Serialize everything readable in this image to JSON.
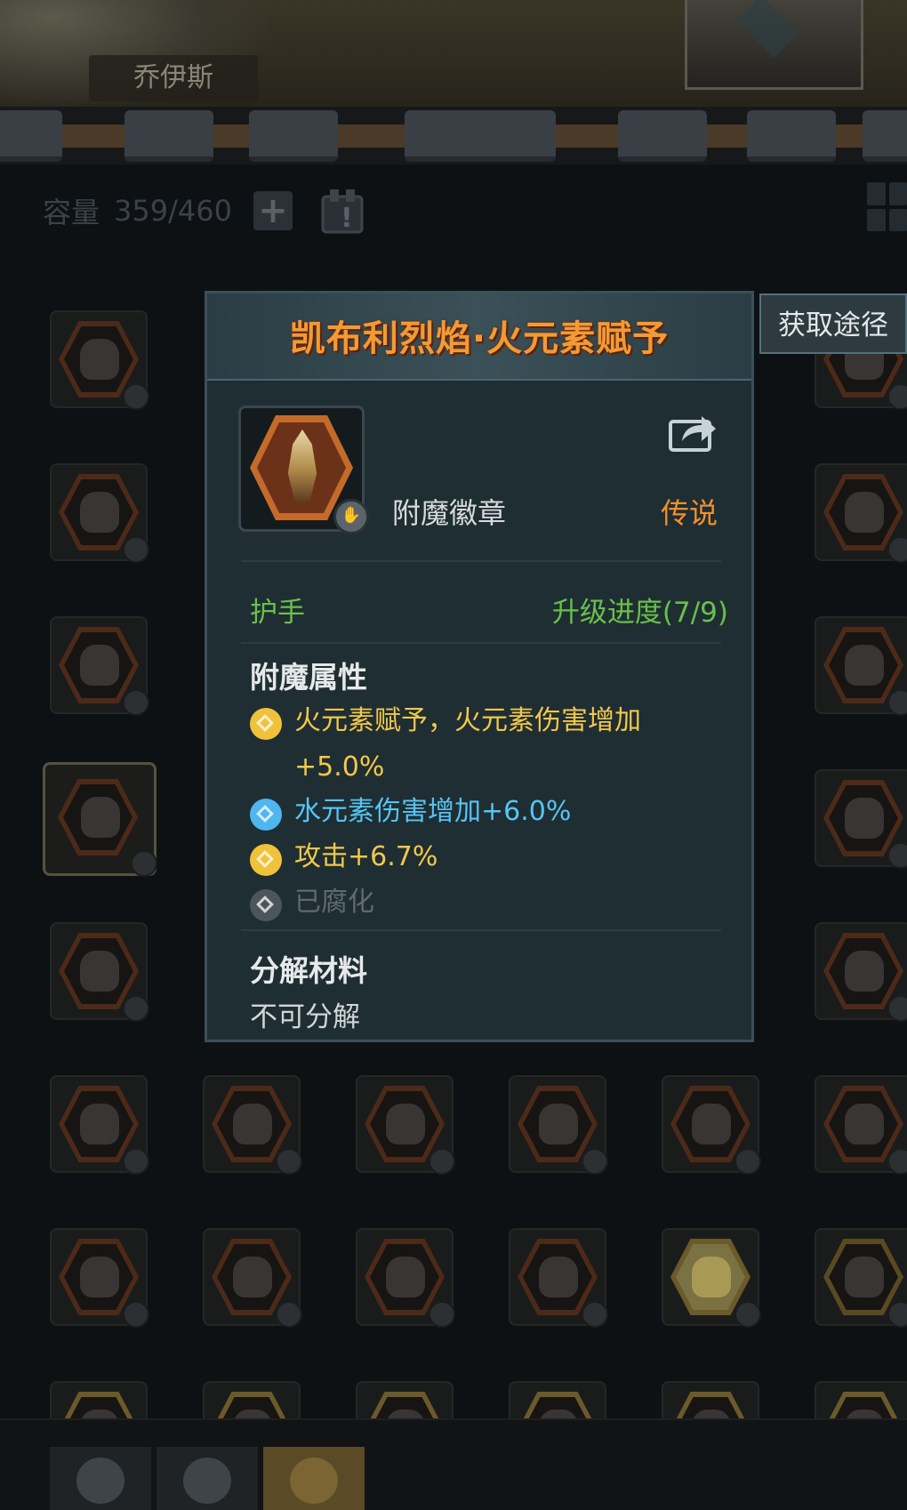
{
  "header": {
    "character_name": "乔伊斯"
  },
  "inventory": {
    "capacity_label": "容量",
    "capacity_value": "359/460",
    "add_button": "+",
    "sort_label": "!"
  },
  "popup": {
    "title": "凯布利烈焰·火元素赋予",
    "item_type": "附魔徽章",
    "rarity": "传说",
    "slot": "护手",
    "upgrade_progress": "升级进度(7/9)",
    "attributes_title": "附魔属性",
    "attributes": [
      {
        "text": "火元素赋予，火元素伤害增加+5.0%",
        "color": "gold"
      },
      {
        "text": "水元素伤害增加+6.0%",
        "color": "blue"
      },
      {
        "text": "攻击+6.7%",
        "color": "gold"
      },
      {
        "text": "已腐化",
        "color": "gray"
      }
    ],
    "decompose_title": "分解材料",
    "decompose_value": "不可分解"
  },
  "side_button": {
    "label": "获取途径"
  },
  "colors": {
    "title_orange": "#f39a35",
    "rarity_orange": "#f2902c",
    "green": "#6ac04a",
    "gold_attr": "#f2c84a",
    "blue_attr": "#56c4f2",
    "gray_attr": "#5f6a70"
  }
}
